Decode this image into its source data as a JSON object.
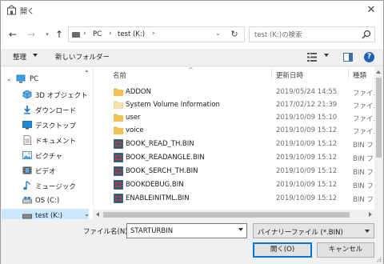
{
  "window": {
    "title": "開く",
    "close_glyph": "✕"
  },
  "navbar": {
    "breadcrumb": [
      "PC",
      "test (K:)"
    ],
    "search_placeholder": "test (K:)の検索"
  },
  "commandbar": {
    "organize_label": "整理",
    "new_folder_label": "新しいフォルダー"
  },
  "nav_pane": {
    "items": [
      {
        "label": "PC",
        "icon": "pc-icon",
        "selected": false
      },
      {
        "label": "3D オブジェクト",
        "icon": "3d-objects-icon",
        "selected": false
      },
      {
        "label": "ダウンロード",
        "icon": "download-icon",
        "selected": false
      },
      {
        "label": "デスクトップ",
        "icon": "desktop-icon",
        "selected": false
      },
      {
        "label": "ドキュメント",
        "icon": "documents-icon",
        "selected": false
      },
      {
        "label": "ピクチャ",
        "icon": "pictures-icon",
        "selected": false
      },
      {
        "label": "ビデオ",
        "icon": "videos-icon",
        "selected": false
      },
      {
        "label": "ミュージック",
        "icon": "music-icon",
        "selected": false
      },
      {
        "label": "OS (C:)",
        "icon": "drive-icon",
        "selected": false
      },
      {
        "label": "test (K:)",
        "icon": "usb-drive-icon",
        "selected": true
      }
    ]
  },
  "file_list": {
    "columns": {
      "name": "名前",
      "date": "更新日時",
      "type": "種類"
    },
    "rows": [
      {
        "name": "ADDON",
        "date": "2019/05/24 14:55",
        "type": "ファイル",
        "kind": "folder"
      },
      {
        "name": "System Volume Information",
        "date": "2017/02/12 21:39",
        "type": "ファイル",
        "kind": "folder-system"
      },
      {
        "name": "user",
        "date": "2019/10/09 15:10",
        "type": "ファイル",
        "kind": "folder"
      },
      {
        "name": "voice",
        "date": "2019/10/09 15:12",
        "type": "ファイル",
        "kind": "folder"
      },
      {
        "name": "BOOK_READ_TH.BIN",
        "date": "2019/10/09 15:12",
        "type": "BIN ファ",
        "kind": "bin"
      },
      {
        "name": "BOOK_READANGLE.BIN",
        "date": "2019/10/09 15:12",
        "type": "BIN ファ",
        "kind": "bin"
      },
      {
        "name": "BOOK_SERCH_TH.BIN",
        "date": "2019/10/09 15:12",
        "type": "BIN ファ",
        "kind": "bin"
      },
      {
        "name": "BOOKDEBUG.BIN",
        "date": "2019/10/09 15:12",
        "type": "BIN ファ",
        "kind": "bin"
      },
      {
        "name": "ENABLEINITML.BIN",
        "date": "2019/10/09 15:12",
        "type": "BIN ファ",
        "kind": "bin"
      }
    ]
  },
  "footer": {
    "filename_label": "ファイル名(N):",
    "filename_value": "STARTURBIN",
    "filetype_value": "バイナリーファイル (*.BIN)",
    "open_label": "開く(O)",
    "cancel_label": "キャンセル"
  },
  "colors": {
    "selection": "#cce8ff",
    "folder": "#f3c44f",
    "accent": "#0078d7"
  }
}
